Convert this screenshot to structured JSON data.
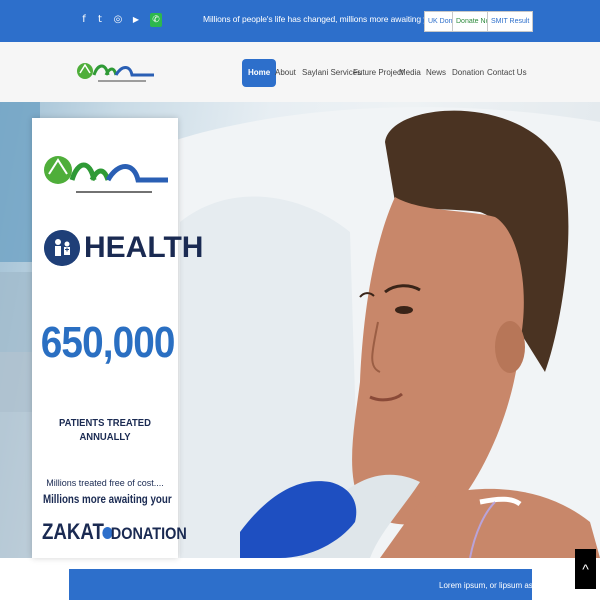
{
  "topbar": {
    "social": [
      {
        "icon": "facebook-icon",
        "glyph": "f"
      },
      {
        "icon": "twitter-icon",
        "glyph": "t"
      },
      {
        "icon": "instagram-icon",
        "glyph": "◎"
      },
      {
        "icon": "youtube-icon",
        "glyph": "▶"
      },
      {
        "icon": "whatsapp-icon",
        "glyph": "✆"
      }
    ],
    "tagline": "Millions of people's life has changed, millions more awaiting your donation",
    "buttons": {
      "uk_donor": "UK Donor",
      "donate_now": "Donate Now",
      "smit_result": "SMIT Result"
    }
  },
  "navbar": {
    "items": [
      "Home",
      "About",
      "Saylani Services",
      "Future Project",
      "Media",
      "News",
      "Donation",
      "Contact Us"
    ],
    "active_index": 0
  },
  "promo": {
    "heading": "HEALTH",
    "number": "650,000",
    "patients": "PATIENTS TREATED ANNUALLY",
    "free": "Millions treated free of cost....",
    "awaiting": "Millions more awaiting your",
    "zakat": "ZAKAT",
    "donation": "DONATION"
  },
  "ticker": {
    "text": "Lorem ipsum, or lipsum as it is some"
  },
  "colors": {
    "brand_blue": "#2d6fcb",
    "navy": "#1a2a52",
    "brand_green": "#2e8b3d"
  },
  "scroll_top": {
    "glyph": "^"
  }
}
